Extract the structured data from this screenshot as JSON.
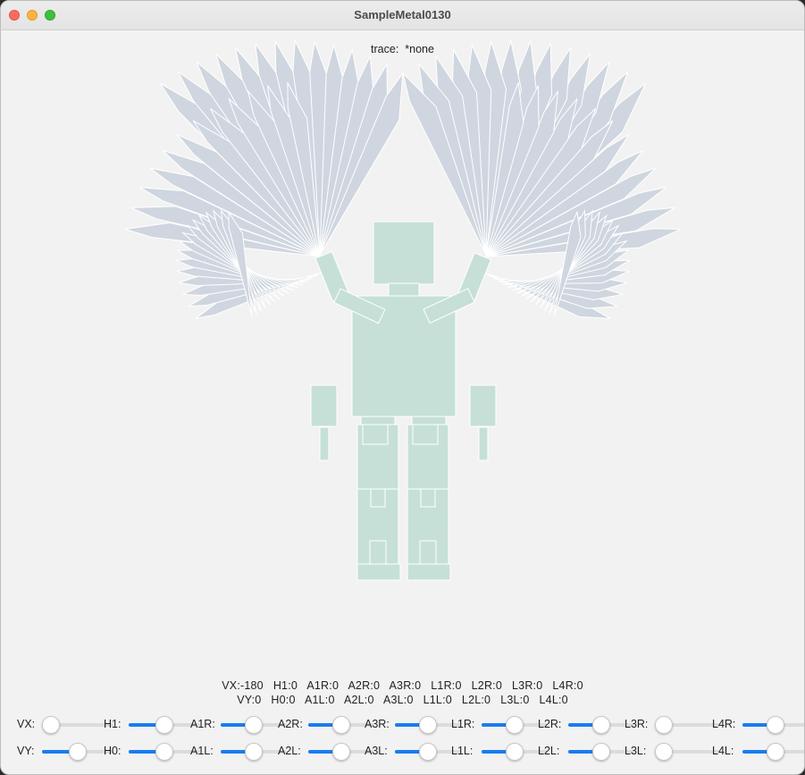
{
  "window": {
    "title": "SampleMetal0130"
  },
  "trace": {
    "label": "trace:",
    "value": "*none",
    "text": "trace:  *none"
  },
  "readout": {
    "line1": "VX:-180   H1:0   A1R:0   A2R:0   A3R:0   L1R:0   L2R:0   L3R:0   L4R:0",
    "line2": "VY:0   H0:0   A1L:0   A2L:0   A3L:0   L1L:0   L2L:0   L3L:0   L4L:0"
  },
  "sliders_row1": [
    {
      "label": "VX:",
      "value": 0.0
    },
    {
      "label": "H1:",
      "value": 0.5
    },
    {
      "label": "A1R:",
      "value": 0.5
    },
    {
      "label": "A2R:",
      "value": 0.5
    },
    {
      "label": "A3R:",
      "value": 0.5
    },
    {
      "label": "L1R:",
      "value": 0.5
    },
    {
      "label": "L2R:",
      "value": 0.5
    },
    {
      "label": "L3R:",
      "value": 0.0
    },
    {
      "label": "L4R:",
      "value": 0.5
    }
  ],
  "sliders_row2": [
    {
      "label": "VY:",
      "value": 0.5
    },
    {
      "label": "H0:",
      "value": 0.5
    },
    {
      "label": "A1L:",
      "value": 0.5
    },
    {
      "label": "A2L:",
      "value": 0.5
    },
    {
      "label": "A3L:",
      "value": 0.5
    },
    {
      "label": "L1L:",
      "value": 0.5
    },
    {
      "label": "L2L:",
      "value": 0.5
    },
    {
      "label": "L3L:",
      "value": 0.0
    },
    {
      "label": "L4L:",
      "value": 0.5
    }
  ],
  "colors": {
    "wing": "#cfd6df",
    "body": "#c6e0d7",
    "accent": "#1a7cf0",
    "background": "#f2f2f2"
  }
}
